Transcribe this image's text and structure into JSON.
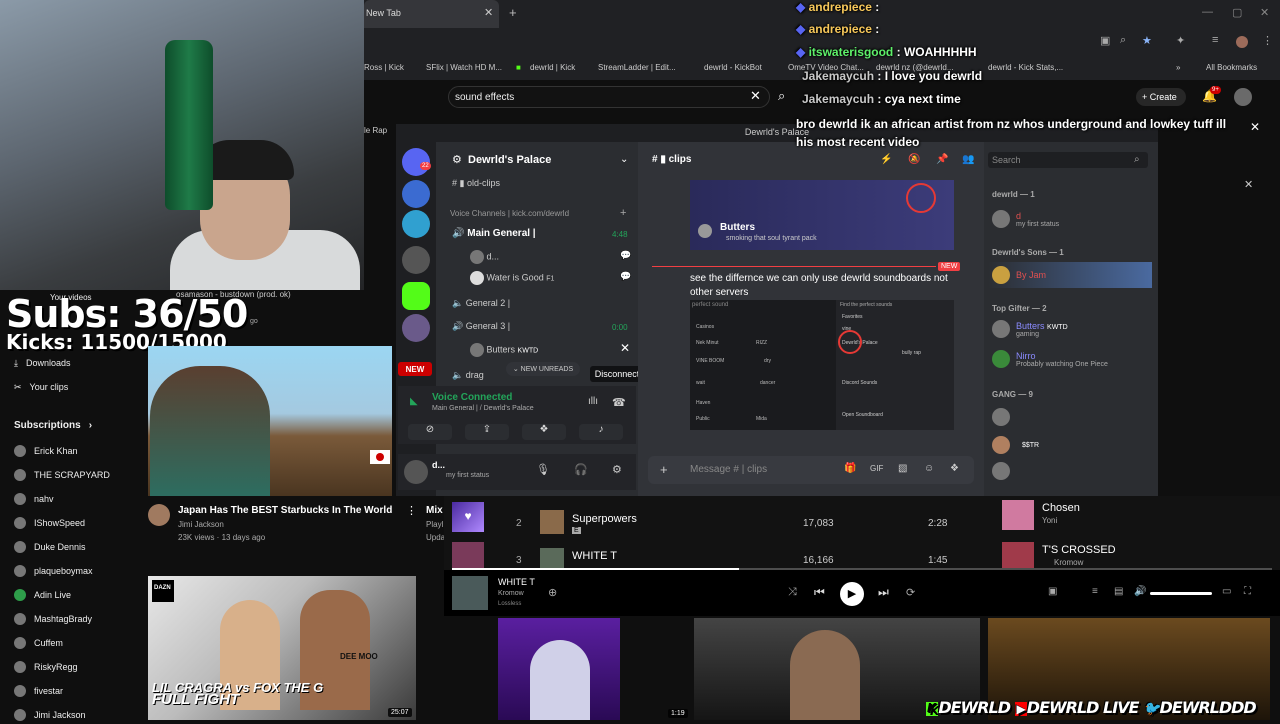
{
  "browser": {
    "tab_title": "New Tab",
    "bookmarks": [
      "Ross | Kick",
      "SFlix | Watch HD M...",
      "dewrld | Kick",
      "StreamLadder | Edit...",
      "dewrld - KickBot",
      "OmeTV Video Chat...",
      "dewrld nz (@dewrld...",
      "dewrld - Kick Stats,..."
    ],
    "all_bookmarks": "All Bookmarks"
  },
  "youtube": {
    "search_value": "sound effects",
    "create_label": "Create",
    "notif_badge": "9+",
    "tab_labels": [
      "Your videos",
      "Downloads",
      "Your clips"
    ],
    "subscriptions_label": "Subscriptions",
    "subscriptions": [
      "Erick Khan",
      "THE SCRAPYARD",
      "nahv",
      "IShowSpeed",
      "Duke Dennis",
      "plaqueboymax",
      "Adin Live",
      "MashtagBrady",
      "Cuffem",
      "RiskyRegg",
      "fivestar",
      "Jimi Jackson"
    ],
    "now_playing_strip": "osamason - bustdown (prod. ok)",
    "ago_fragment": "go",
    "rap_fragment": "le Rap",
    "video1": {
      "title": "Japan Has The BEST Starbucks In The World",
      "channel": "Jimi Jackson",
      "meta": "23K views · 13 days ago",
      "new_badge": "NEW"
    },
    "mix_label": "Mix",
    "mix_sub1": "Playl",
    "mix_sub2": "Upda",
    "video2": {
      "brand": "DAZN",
      "title_line1": "LIL CRAGRA vs FOX THE G",
      "title_line2": "FULL FIGHT",
      "duration": "25:07",
      "shirt_text": "DEE MOO"
    }
  },
  "overlay": {
    "subs": "Subs: 36/50",
    "kicks": "Kicks: 11500/15000",
    "banner": [
      {
        "icon": "kick-icon",
        "text": "DEWRLD"
      },
      {
        "icon": "youtube-icon",
        "text": "DEWRLD LIVE"
      },
      {
        "icon": "twitter-icon",
        "text": "DEWRLDDD"
      }
    ],
    "cam_duration": "1:19"
  },
  "chat_overlay": [
    {
      "user": "andrepiece",
      "text": ":",
      "color": "#f7c85a"
    },
    {
      "user": "andrepiece",
      "text": ":",
      "color": "#f7c85a"
    },
    {
      "user": "itswaterisgood",
      "text": ": WOAHHHHH",
      "color": "#5ef06a"
    },
    {
      "user": "Jakemaycuh",
      "text": ": I love you dewrld",
      "color": "#c9c9c9"
    },
    {
      "user": "Jakemaycuh",
      "text": ": cya next time",
      "color": "#c9c9c9"
    },
    {
      "user": "",
      "text": "bro dewrld ik an african artist from nz whos underground and lowkey tuff ill",
      "color": "#fff"
    },
    {
      "user": "",
      "text": "his most recent video",
      "color": "#fff"
    }
  ],
  "discord": {
    "window_title": "Dewrld's Palace",
    "server_name": "Dewrld's Palace",
    "server_badges": [
      "22",
      "1",
      "1",
      "2",
      "2",
      "7",
      "3"
    ],
    "channels": {
      "old_clips": "old-clips",
      "voice_header": "Voice Channels | kick.com/dewrld",
      "main_general": "Main General |",
      "main_time": "4:48",
      "user1": "d...",
      "user2": "Water is Good",
      "user2_tag": "F1",
      "general2": "General 2 |",
      "general3": "General 3 |",
      "general3_time": "0:00",
      "butters": "Butters",
      "butters_tag": "KWTD",
      "drag": "drag",
      "new_unreads": "NEW UNREADS",
      "disconnect": "Disconnect"
    },
    "voice_panel": {
      "status": "Voice Connected",
      "location": "Main General | / Dewrld's Palace"
    },
    "userbar": {
      "name": "d...",
      "status": "my first status"
    },
    "chat": {
      "channel": "clips",
      "embed_user": "Butters",
      "embed_status": "smoking that soul tyrant pack",
      "new_label": "NEW",
      "message": "see the differnce we can only use dewrld soundboards not other servers",
      "placeholder": "Message # | clips",
      "mini_title": "perfect sound",
      "mini_items": [
        "Casinos",
        "Nek Minut",
        "RIZZ",
        "VINE BOOM",
        "dry",
        "wait",
        "dancer",
        "Haven",
        "Public",
        "Mida"
      ],
      "mini_right_title": "Find the perfect sounds",
      "mini_right_items": [
        "Favorites",
        "vine",
        "Dewrld's Palace",
        "bully rap",
        "Discord Sounds",
        "Open Soundboard"
      ]
    },
    "search_placeholder": "Search",
    "members": {
      "groups": [
        {
          "header": "dewrld — 1",
          "rows": [
            {
              "name": "d",
              "sub": "my first status",
              "color": "#e05050"
            }
          ]
        },
        {
          "header": "Dewrld's Sons — 1",
          "rows": [
            {
              "name": "By Jam",
              "sub": "",
              "color": "#e05050"
            }
          ]
        },
        {
          "header": "Top Gifter — 2",
          "rows": [
            {
              "name": "Butters",
              "sub": "gaming",
              "tag": "KWTD",
              "color": "#8b8bff"
            },
            {
              "name": "Nirro",
              "sub": "Probably watching One Piece",
              "color": "#8b8bff"
            }
          ]
        },
        {
          "header": "GANG — 9",
          "rows": [
            {
              "name": "",
              "sub": "",
              "color": "#8b8bff"
            },
            {
              "name": "",
              "sub": "",
              "tag": "$$TR",
              "color": "#8b8bff"
            },
            {
              "name": "",
              "sub": "",
              "color": "#8b8bff"
            }
          ]
        }
      ]
    }
  },
  "spotify": {
    "rows": [
      {
        "num": "2",
        "title": "Superpowers",
        "badge": "E",
        "plays": "17,083",
        "duration": "2:28"
      },
      {
        "num": "3",
        "title": "WHITE T",
        "badge": "E",
        "plays": "16,166",
        "duration": "1:45"
      }
    ],
    "side": [
      {
        "title": "Chosen",
        "artist": "Yoni"
      },
      {
        "title": "T'S CROSSED",
        "artist": "Kromow"
      }
    ],
    "now_playing": {
      "title": "WHITE T",
      "artist": "Kromow",
      "quality": "Lossless"
    }
  },
  "colors": {
    "discord_green": "#23a55a",
    "discord_bg": "#313338",
    "kick_green": "#53fc18",
    "youtube_red": "#ff0000",
    "accent_red": "#e53935"
  }
}
